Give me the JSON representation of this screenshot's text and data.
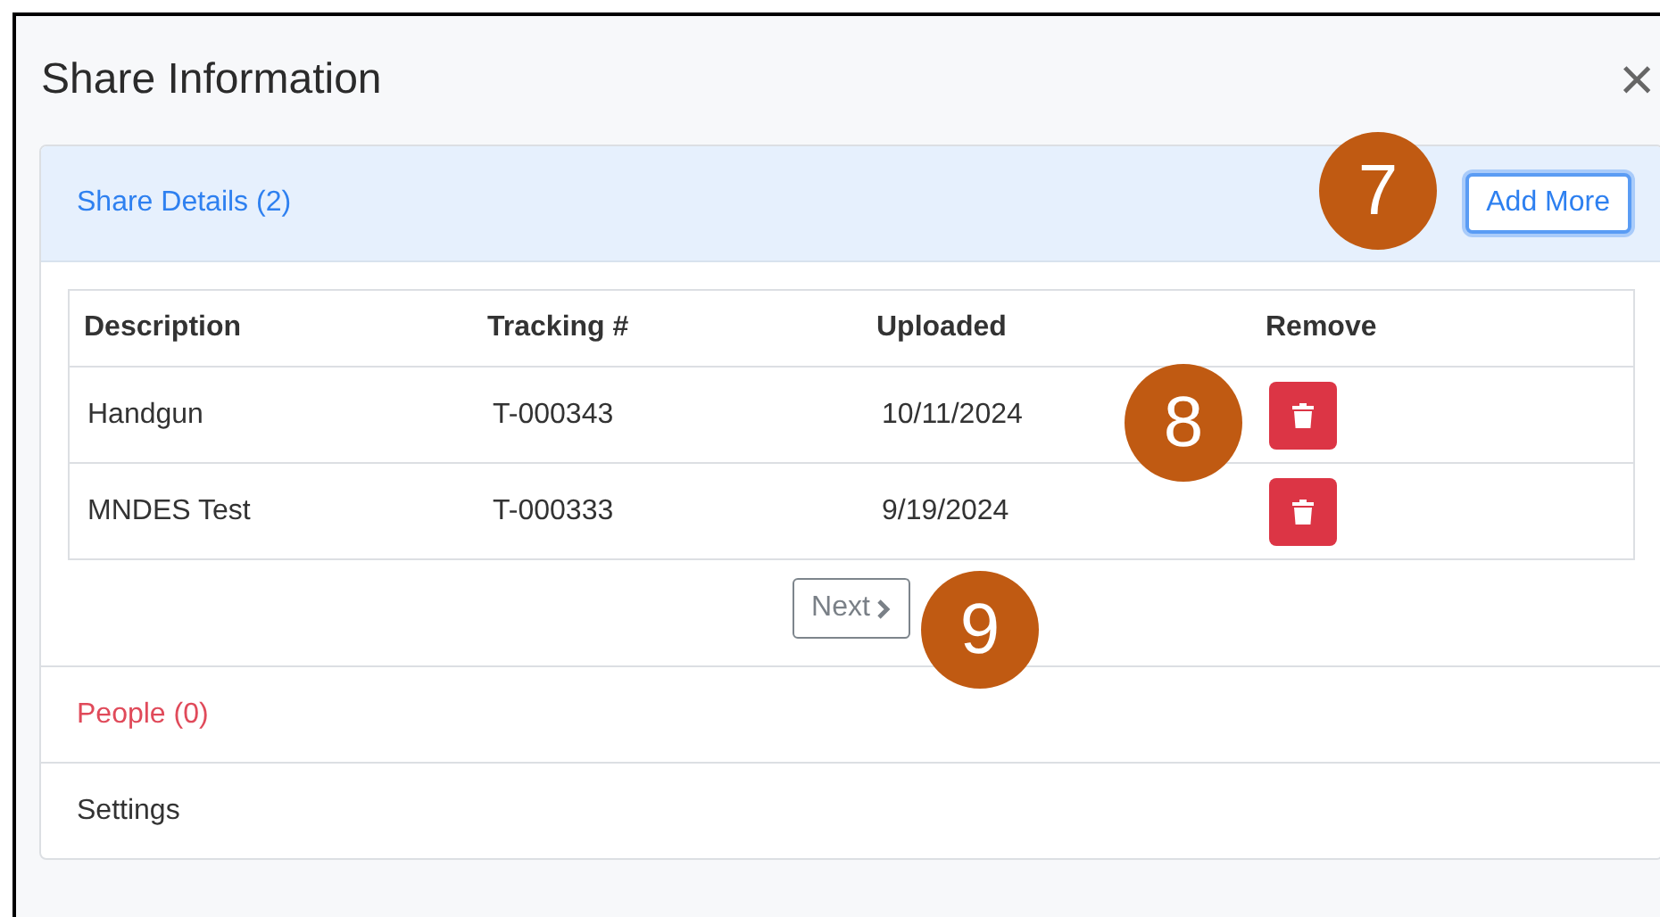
{
  "dialog": {
    "title": "Share Information",
    "close": "×"
  },
  "sections": [
    {
      "kind": "active",
      "label": "Share Details (2)",
      "expanded": true,
      "action": "Add More",
      "action_focused": true,
      "table": {
        "columns": [
          "Description",
          "Tracking #",
          "Uploaded",
          "Remove"
        ],
        "rows": [
          {
            "description": "Handgun",
            "tracking": "T-000343",
            "uploaded": "10/11/2024"
          },
          {
            "description": "MNDES Test",
            "tracking": "T-000333",
            "uploaded": "9/19/2024"
          }
        ]
      },
      "pager": {
        "label": "Next",
        "disabled": true
      }
    },
    {
      "kind": "invalid",
      "label": "People (0)",
      "expanded": false
    },
    {
      "kind": "normal",
      "label": "Settings",
      "expanded": false
    }
  ],
  "callouts": [
    {
      "label": "7"
    },
    {
      "label": "8"
    },
    {
      "label": "9"
    }
  ]
}
